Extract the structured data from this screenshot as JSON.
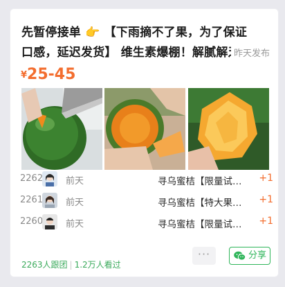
{
  "post": {
    "title_part1": "先暂停接单",
    "title_emoji": "👉",
    "title_part2": "【下雨摘不了果，为了保证口感，延迟发货】 维生素爆棚！解腻解乏",
    "time": "昨天发布",
    "price_symbol": "¥",
    "price_range": "25-45",
    "images": [
      "orange-being-cut-image",
      "peeled-orange-in-hand-image",
      "orange-segments-image"
    ]
  },
  "orders": [
    {
      "num": "2262",
      "when": "前天",
      "product": "寻乌蜜桔【限量试…",
      "plus": "+1",
      "avatar": "avatar-girl"
    },
    {
      "num": "2261",
      "when": "前天",
      "product": "寻乌蜜桔【特大果…",
      "plus": "+1",
      "avatar": "avatar-woman"
    },
    {
      "num": "2260",
      "when": "前天",
      "product": "寻乌蜜桔【限量试…",
      "plus": "+1",
      "avatar": "avatar-man"
    }
  ],
  "stats": {
    "followers": "2263人跟团",
    "views": "1.2万人看过"
  },
  "actions": {
    "more": "···",
    "share": "分享"
  },
  "colors": {
    "price": "#f36d2e",
    "green": "#2fb55a"
  }
}
